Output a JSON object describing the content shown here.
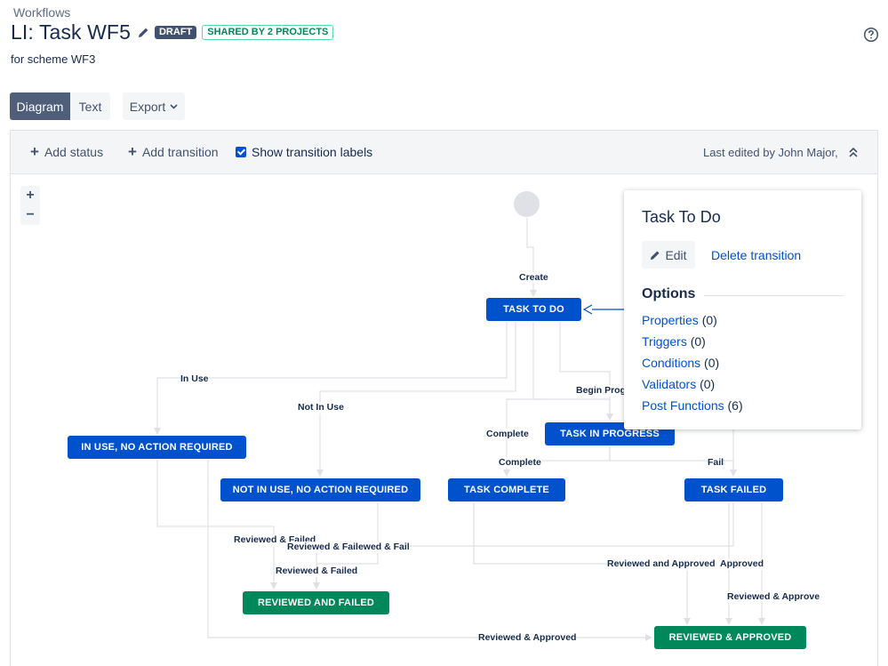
{
  "header": {
    "breadcrumb": "Workflows",
    "title": "LI: Task WF5",
    "badge_draft": "DRAFT",
    "badge_shared": "SHARED BY 2 PROJECTS",
    "subtitle": "for scheme WF3",
    "help_icon": "question-circle-icon"
  },
  "view_tabs": [
    {
      "label": "Diagram",
      "active": true
    },
    {
      "label": "Text",
      "active": false
    }
  ],
  "export": {
    "label": "Export"
  },
  "toolbar": {
    "add_status": "Add status",
    "add_transition": "Add transition",
    "show_labels": "Show transition labels",
    "show_labels_checked": true,
    "last_edited": "Last edited by John Major,"
  },
  "zoom": {
    "in": "+",
    "out": "−"
  },
  "statuses": {
    "todo": "TASK TO DO",
    "in_use": "IN USE, NO ACTION REQUIRED",
    "not_in_use": "NOT IN USE, NO ACTION REQUIRED",
    "in_progress": "TASK IN PROGRESS",
    "complete": "TASK COMPLETE",
    "failed": "TASK FAILED",
    "reviewed_failed": "REVIEWED AND FAILED",
    "reviewed_approved": "REVIEWED & APPROVED"
  },
  "transitions": {
    "create": "Create",
    "in_use": "In Use",
    "not_in_use": "Not In Use",
    "begin_progress": "Begin Prog",
    "complete_1": "Complete",
    "complete_2": "Complete",
    "fail": "Fail",
    "rf_1": "Reviewed & Failed",
    "rf_2": "Reviewed & Failewed & Fail",
    "rf_3": "Reviewed & Failed",
    "ra_1": "Reviewed and Approved",
    "ra_2": "Approved",
    "ra_3": "Reviewed & Approve",
    "ra_4": "Reviewed & Approved"
  },
  "panel": {
    "title": "Task To Do",
    "edit_label": "Edit",
    "delete_label": "Delete transition",
    "options_heading": "Options",
    "options": [
      {
        "label": "Properties",
        "count": "(0)"
      },
      {
        "label": "Triggers",
        "count": "(0)"
      },
      {
        "label": "Conditions",
        "count": "(0)"
      },
      {
        "label": "Validators",
        "count": "(0)"
      },
      {
        "label": "Post Functions",
        "count": "(6)"
      }
    ]
  },
  "colors": {
    "status_blue": "#0052cc",
    "status_green": "#00875a",
    "tab_active": "#505f79",
    "link": "#0052cc"
  }
}
